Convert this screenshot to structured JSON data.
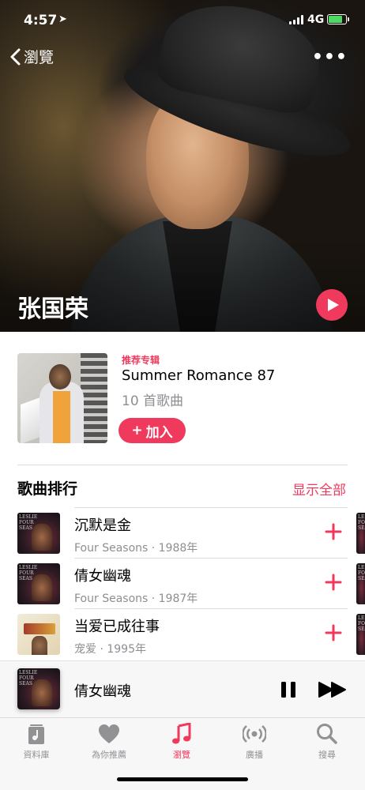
{
  "status_bar": {
    "time": "4:57",
    "location_icon": "location-arrow-icon",
    "network": "4G",
    "battery_color": "#4cd964"
  },
  "nav": {
    "back_label": "瀏覽",
    "more_icon": "more-dots-icon"
  },
  "hero": {
    "artist_name": "张国荣",
    "play_icon": "play-icon"
  },
  "featured": {
    "label": "推荐专辑",
    "album_title": "Summer Romance 87",
    "song_count": "10 首歌曲",
    "add_label": "加入"
  },
  "top_songs": {
    "section_title": "歌曲排行",
    "show_all_label": "显示全部",
    "songs": [
      {
        "title": "沉默是金",
        "subtitle": "Four Seasons · 1988年",
        "art": "dark"
      },
      {
        "title": "倩女幽魂",
        "subtitle": "Four Seasons · 1987年",
        "art": "dark"
      },
      {
        "title": "当爱已成往事",
        "subtitle": "宠爱 · 1995年",
        "art": "light"
      }
    ]
  },
  "now_playing": {
    "title": "倩女幽魂"
  },
  "tab_bar": {
    "tabs": [
      {
        "label": "資料庫",
        "icon": "library-icon",
        "active": false
      },
      {
        "label": "為你推薦",
        "icon": "heart-icon",
        "active": false
      },
      {
        "label": "瀏覽",
        "icon": "music-note-icon",
        "active": true
      },
      {
        "label": "廣播",
        "icon": "radio-icon",
        "active": false
      },
      {
        "label": "搜尋",
        "icon": "search-icon",
        "active": false
      }
    ]
  },
  "colors": {
    "accent": "#ef3a5d",
    "secondary_text": "#8e8e93"
  }
}
